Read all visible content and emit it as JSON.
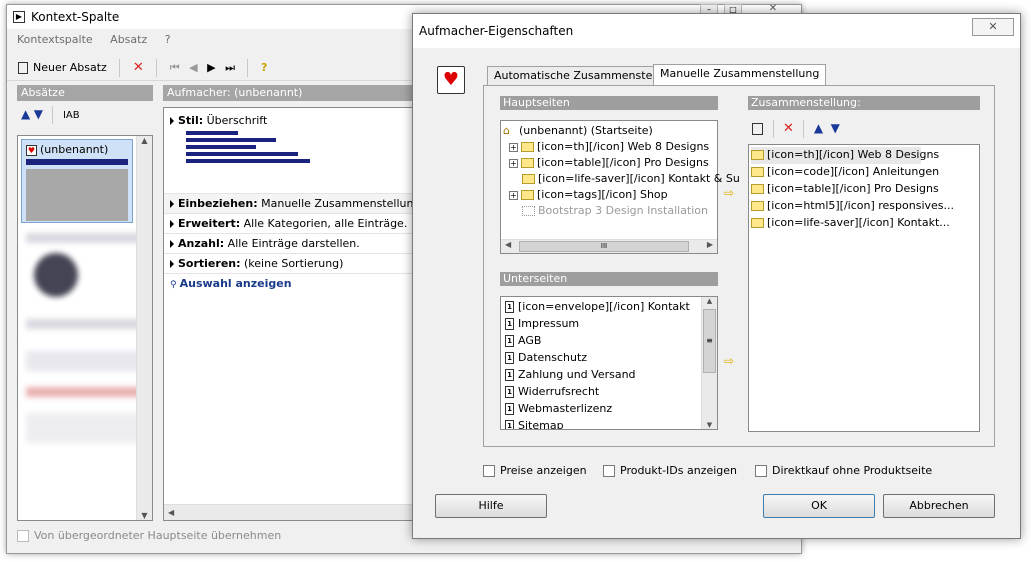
{
  "bg": {
    "title": "Kontext-Spalte",
    "menu": [
      "Kontextspalte",
      "Absatz",
      "?"
    ],
    "new_label": "Neuer Absatz",
    "left_header": "Absätze",
    "abc": "AB",
    "selected_item": "(unbenannt)",
    "right_header": "Aufmacher: (unbenannt)",
    "stil_label": "Stil:",
    "stil_value": "Überschrift",
    "props": [
      {
        "label": "Einbeziehen:",
        "value": "Manuelle Zusammenstellung."
      },
      {
        "label": "Erweitert:",
        "value": "Alle Kategorien, alle Einträge."
      },
      {
        "label": "Anzahl:",
        "value": "Alle Einträge darstellen."
      },
      {
        "label": "Sortieren:",
        "value": "(keine Sortierung)"
      }
    ],
    "auswahl": "Auswahl anzeigen",
    "inherit_label": "Von übergeordneter Hauptseite übernehmen"
  },
  "dlg": {
    "title": "Aufmacher-Eigenschaften",
    "close": "✕",
    "tabs": [
      "Automatische Zusammenstellung",
      "Manuelle Zusammenstellung"
    ],
    "hauptseiten_header": "Hauptseiten",
    "hauptseiten": [
      {
        "text": "(unbenannt) (Startseite)",
        "kind": "home"
      },
      {
        "text": "[icon=th][/icon] Web 8 Designs",
        "kind": "folder",
        "plus": true
      },
      {
        "text": "[icon=table][/icon] Pro Designs",
        "kind": "folder",
        "plus": true
      },
      {
        "text": "[icon=life-saver][/icon] Kontakt & Su",
        "kind": "folder",
        "plus": false
      },
      {
        "text": "[icon=tags][/icon] Shop",
        "kind": "folder",
        "plus": true
      },
      {
        "text": "Bootstrap 3 Design Installation",
        "kind": "dotted",
        "plus": false
      }
    ],
    "hscroll_grip": "III",
    "unterseiten_header": "Unterseiten",
    "unterseiten": [
      "[icon=envelope][/icon] Kontakt",
      "Impressum",
      "AGB",
      "Datenschutz",
      "Zahlung und Versand",
      "Widerrufsrecht",
      "Webmasterlizenz",
      "Sitemap"
    ],
    "zusammen_header": "Zusammenstellung:",
    "zusammenstellung": [
      "[icon=th][/icon] Web 8 Designs",
      "[icon=code][/icon] Anleitungen",
      "[icon=table][/icon] Pro Designs",
      "[icon=html5][/icon] responsives...",
      "[icon=life-saver][/icon] Kontakt..."
    ],
    "checkboxes": [
      "Preise anzeigen",
      "Produkt-IDs anzeigen",
      "Direktkauf ohne Produktseite"
    ],
    "help": "Hilfe",
    "ok": "OK",
    "cancel": "Abbrechen"
  }
}
